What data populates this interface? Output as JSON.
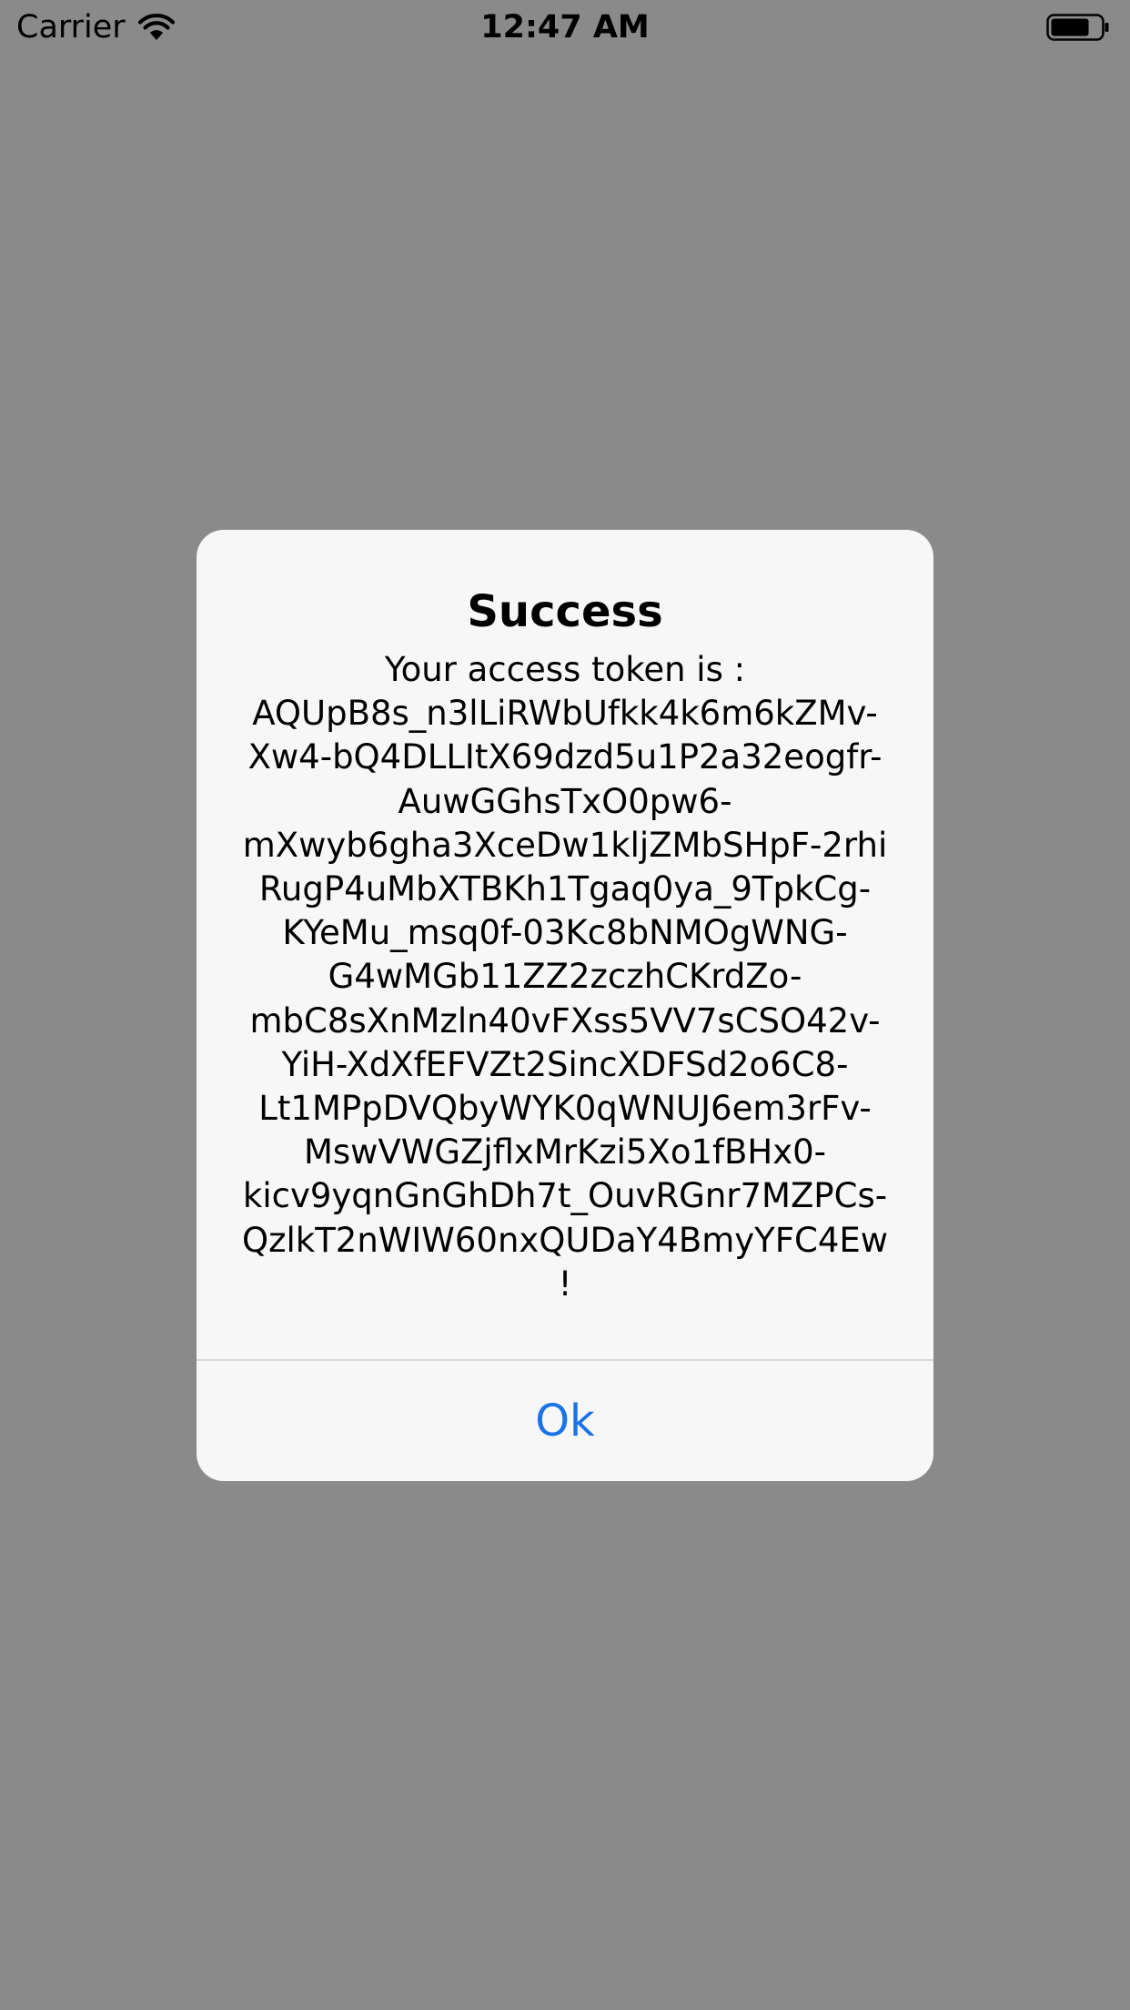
{
  "status_bar": {
    "carrier": "Carrier",
    "time": "12:47 AM",
    "wifi_icon": "wifi-icon",
    "battery_icon": "battery-icon"
  },
  "alert": {
    "title": "Success",
    "message_lines": [
      "Your access token is :",
      "AQUpB8s_n3lLiRWbUfkk4k6m6kZMv-",
      "Xw4-bQ4DLLItX69dzd5u1P2a32eogfr-",
      "AuwGGhsTxO0pw6-",
      "mXwyb6gha3XceDw1kljZMbSHpF-2rhi",
      "RugP4uMbXTBKh1Tgaq0ya_9TpkCg-",
      "KYeMu_msq0f-03Kc8bNMOgWNG-",
      "G4wMGb11ZZ2zczhCKrdZo-",
      "mbC8sXnMzln40vFXss5VV7sCSO42v-",
      "YiH-XdXfEFVZt2SincXDFSd2o6C8-",
      "Lt1MPpDVQbyWYK0qWNUJ6em3rFv-",
      "MswVWGZjflxMrKzi5Xo1fBHx0-",
      "kicv9yqnGnGhDh7t_OuvRGnr7MZPCs-",
      "QzlkT2nWIW60nxQUDaY4BmyYFC4Ew",
      "!"
    ],
    "ok_label": "Ok"
  },
  "colors": {
    "backdrop": "#8a8a8a",
    "alert_background": "#f7f7f7",
    "button_text": "#1a73e8"
  }
}
